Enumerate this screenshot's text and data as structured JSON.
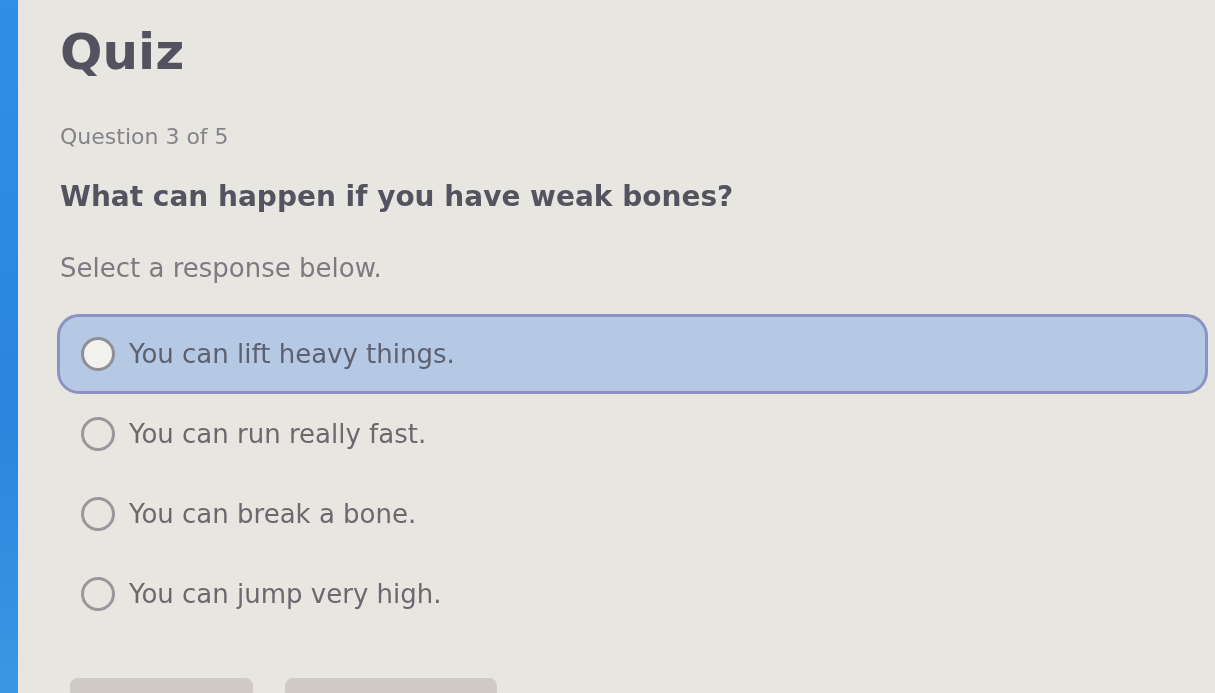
{
  "quiz": {
    "title": "Quiz",
    "progress": "Question 3 of 5"
  },
  "question": {
    "prompt": "What can happen if you have weak bones?",
    "instruction": "Select a response below.",
    "options": [
      {
        "label": "You can lift heavy things.",
        "selected": true
      },
      {
        "label": "You can run really fast.",
        "selected": false
      },
      {
        "label": "You can break a bone.",
        "selected": false
      },
      {
        "label": "You can jump very high.",
        "selected": false
      }
    ]
  }
}
